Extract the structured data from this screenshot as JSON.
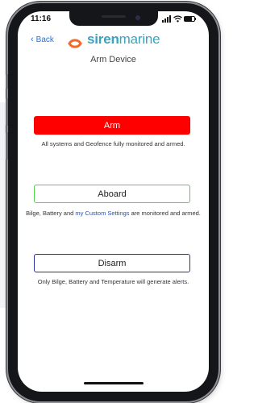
{
  "status_bar": {
    "time": "11:16"
  },
  "header": {
    "back_label": "Back",
    "logo_text_bold": "siren",
    "logo_text_rest": "marine",
    "title": "Arm Device"
  },
  "modes": {
    "arm": {
      "label": "Arm",
      "description": "All systems and Geofence fully monitored and armed.",
      "color": "#ff0000"
    },
    "aboard": {
      "label": "Aboard",
      "description_before": "Bilge, Battery and",
      "description_link": "my Custom Settings",
      "description_after": "are monitored and armed.",
      "color": "#4fd34f"
    },
    "disarm": {
      "label": "Disarm",
      "description": "Only Bilge, Battery and Temperature will generate alerts.",
      "color": "#2a2fa0"
    }
  },
  "icons": [
    "chevron-left-icon",
    "siren-marine-logo-icon",
    "signal-icon",
    "wifi-icon",
    "battery-icon"
  ],
  "colors": {
    "accent_link": "#1a73e8",
    "brand": "#36a5bd",
    "logo_orange": "#f26a2e"
  }
}
